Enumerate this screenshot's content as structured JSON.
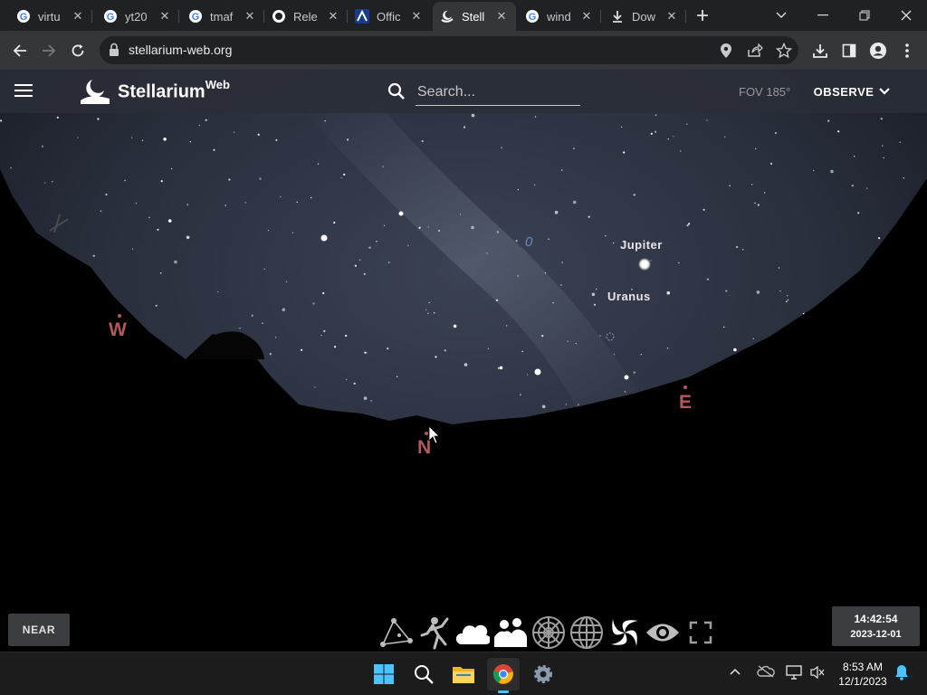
{
  "browser": {
    "tabs": [
      {
        "label": "virtu",
        "favicon": "google-icon",
        "active": false
      },
      {
        "label": "yt20",
        "favicon": "google-icon",
        "active": false
      },
      {
        "label": "tmaf",
        "favicon": "google-icon",
        "active": false
      },
      {
        "label": "Rele",
        "favicon": "github-icon",
        "active": false
      },
      {
        "label": "Offic",
        "favicon": "lambda-icon",
        "active": false
      },
      {
        "label": "Stell",
        "favicon": "stellarium-icon",
        "active": true
      },
      {
        "label": "wind",
        "favicon": "google-icon",
        "active": false
      },
      {
        "label": "Dow",
        "favicon": "download-icon",
        "active": false
      }
    ],
    "address": "stellarium-web.org"
  },
  "app": {
    "brand": "Stellarium",
    "brand_sup": "Web",
    "search_placeholder": "Search...",
    "fov": "FOV 185°",
    "observe_label": "OBSERVE"
  },
  "sky": {
    "labels": {
      "jupiter": "Jupiter",
      "uranus": "Uranus",
      "zero": "0"
    },
    "cardinals": {
      "west": "W",
      "north": "N",
      "east": "E"
    },
    "accent_color": "#b5575c"
  },
  "controls": {
    "near_label": "NEAR",
    "time": "14:42:54",
    "date": "2023-12-01",
    "tools": [
      "constellation-lines-icon",
      "constellation-art-icon",
      "atmosphere-icon",
      "landscape-icon",
      "azimuthal-grid-icon",
      "equatorial-grid-icon",
      "deep-sky-objects-icon",
      "night-mode-icon",
      "fullscreen-icon"
    ]
  },
  "taskbar": {
    "time": "8:53 AM",
    "date": "12/1/2023"
  }
}
